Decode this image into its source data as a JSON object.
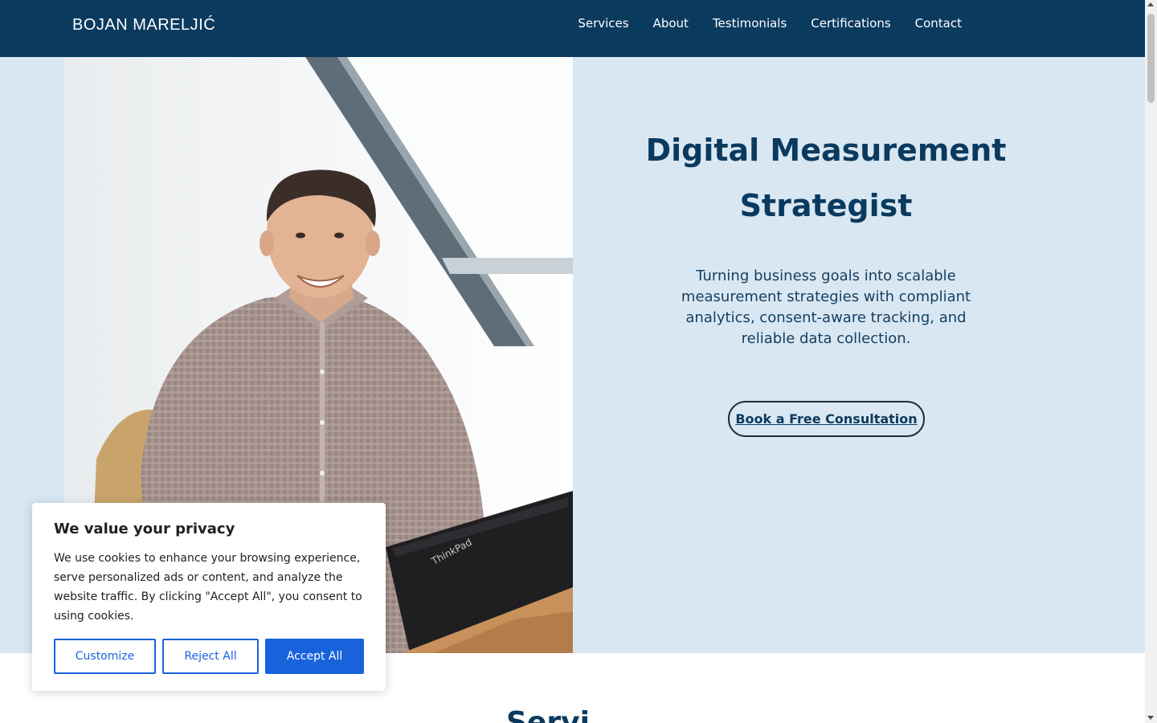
{
  "header": {
    "logo": "BOJAN MARELJIĆ",
    "nav": [
      "Services",
      "About",
      "Testimonials",
      "Certifications",
      "Contact"
    ]
  },
  "hero": {
    "title_line1": "Digital Measurement",
    "title_line2": "Strategist",
    "subtitle": "Turning business goals into scalable measurement strategies with compliant analytics, consent-aware tracking, and reliable data collection.",
    "cta": "Book a Free Consultation",
    "photo_alt": "Portrait photo"
  },
  "next_section": {
    "heading_fragment": "Servi"
  },
  "cookie_banner": {
    "title": "We value your privacy",
    "text": "We use cookies to enhance your browsing experience, serve personalized ads or content, and analyze the website traffic. By clicking \"Accept All\", you consent to using cookies.",
    "customize": "Customize",
    "reject": "Reject All",
    "accept": "Accept All"
  },
  "colors": {
    "header_bg": "#0b3a5f",
    "hero_bg": "#d8e7f2",
    "accent_blue": "#1863dc",
    "text_dark": "#212121"
  }
}
